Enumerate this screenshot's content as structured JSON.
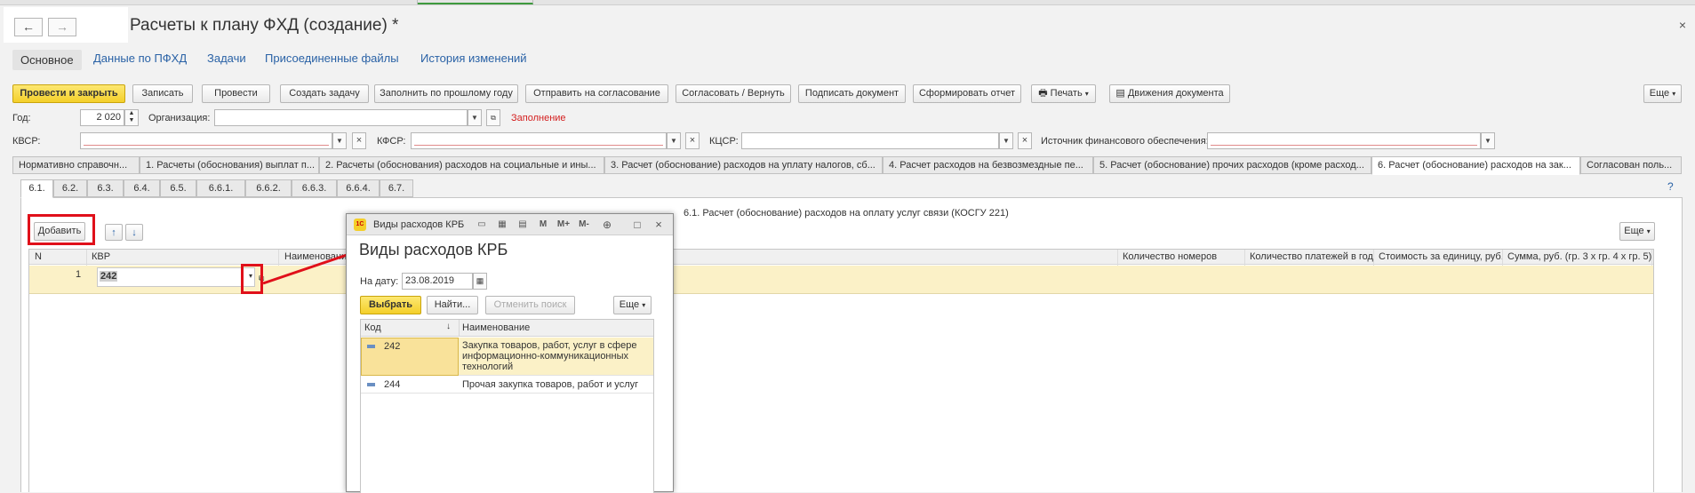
{
  "window": {
    "title": "Расчеты к плану ФХД (создание) *",
    "back_label": "←",
    "forward_label": "→",
    "close_label": "×"
  },
  "top_tabs": [
    "Основное",
    "Данные по ПФХД",
    "Задачи",
    "Присоединенные файлы",
    "История изменений"
  ],
  "toolbar": {
    "post_close": "Провести и закрыть",
    "save": "Записать",
    "post": "Провести",
    "create_task": "Создать задачу",
    "fill_prev": "Заполнить по прошлому году",
    "send_approval": "Отправить на согласование",
    "approve_return": "Согласовать / Вернуть",
    "sign": "Подписать документ",
    "report": "Сформировать отчет",
    "print": "Печать",
    "movements": "Движения документа",
    "more": "Еще"
  },
  "fields": {
    "year_label": "Год:",
    "year_value": "2 020",
    "org_label": "Организация:",
    "org_value": "",
    "fill_status": "Заполнение",
    "kvsr_label": "КВСР:",
    "kfsr_label": "КФСР:",
    "kcsr_label": "КЦСР:",
    "source_label": "Источник финансового обеспечения:"
  },
  "section_tabs": [
    "Нормативно справочн...",
    "1. Расчеты (обоснования) выплат п...",
    "2. Расчеты (обоснования) расходов на социальные и ины...",
    "3. Расчет (обоснование) расходов на уплату налогов, сб...",
    "4. Расчет расходов на безвозмездные пе...",
    "5. Расчет (обоснование) прочих расходов (кроме расход...",
    "6. Расчет (обоснование) расходов на зак...",
    "Согласован поль..."
  ],
  "sub_tabs": [
    "6.1.",
    "6.2.",
    "6.3.",
    "6.4.",
    "6.5.",
    "6.6.1.",
    "6.6.2.",
    "6.6.3.",
    "6.6.4.",
    "6.7."
  ],
  "help_label": "?",
  "subsection": {
    "heading": "6.1. Расчет (обоснование) расходов на оплату услуг связи (КОСГУ 221)",
    "add_button": "Добавить",
    "up_label": "↑",
    "down_label": "↓",
    "more": "Еще",
    "columns": {
      "n": "N",
      "kvr": "КВР",
      "name": "Наименовани",
      "count_numbers": "Количество номеров",
      "payments_per_year": "Количество платежей в год",
      "unit_cost": "Стоимость за единицу, руб.",
      "sum": "Сумма, руб. (гр. 3 х гр. 4 х гр. 5)"
    },
    "rows": [
      {
        "n": "1",
        "kvr": "242"
      }
    ]
  },
  "popup": {
    "window_title": "Виды расходов КРБ",
    "heading": "Виды расходов КРБ",
    "date_label": "На дату:",
    "date_value": "23.08.2019",
    "choose": "Выбрать",
    "find": "Найти...",
    "cancel_search": "Отменить поиск",
    "more": "Еще",
    "col_code": "Код",
    "col_name": "Наименование",
    "rows": [
      {
        "code": "242",
        "name": "Закупка товаров, работ, услуг в сфере информационно-коммуникационных технологий"
      },
      {
        "code": "244",
        "name": "Прочая закупка товаров, работ и услуг"
      }
    ]
  },
  "colors": {
    "accent_yellow": "#f4cf2a",
    "link_blue": "#2a62a6",
    "alert_red": "#e0101a",
    "selection": "#fbf1c7"
  }
}
